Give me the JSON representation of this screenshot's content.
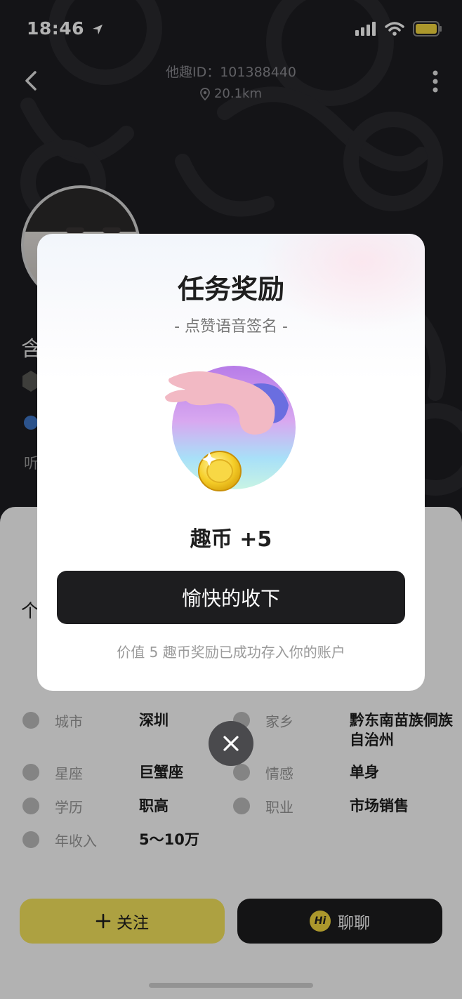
{
  "status_bar": {
    "time": "18:46"
  },
  "profile_header": {
    "id_text": "他趣ID：101388440",
    "distance": "20.1km",
    "name_fragment": "含",
    "bio_fragment": "听"
  },
  "info_sheet": {
    "section_title_fragment": "个",
    "rows": [
      {
        "label": "城市",
        "value": "深圳",
        "icon": "location-icon"
      },
      {
        "label": "家乡",
        "value": "黔东南苗族侗族自治州",
        "icon": "home-icon"
      },
      {
        "label": "星座",
        "value": "巨蟹座",
        "icon": "star-icon"
      },
      {
        "label": "情感",
        "value": "单身",
        "icon": "heart-icon"
      },
      {
        "label": "学历",
        "value": "职高",
        "icon": "graduation-cap-icon"
      },
      {
        "label": "职业",
        "value": "市场销售",
        "icon": "briefcase-icon"
      },
      {
        "label": "年收入",
        "value": "5～10万",
        "icon": "income-icon"
      }
    ]
  },
  "bottom_bar": {
    "follow_label": "关注",
    "chat_label": "聊聊",
    "hi_badge": "Hi"
  },
  "modal": {
    "title": "任务奖励",
    "subtitle": "- 点赞语音签名 -",
    "reward": "趣币 +5",
    "accept_button": "愉快的收下",
    "note": "价值 5 趣币奖励已成功存入你的账户"
  },
  "colors": {
    "accent_yellow": "#f8e75e",
    "dark_button": "#1d1d1f",
    "header_bg": "#1e1e22"
  }
}
